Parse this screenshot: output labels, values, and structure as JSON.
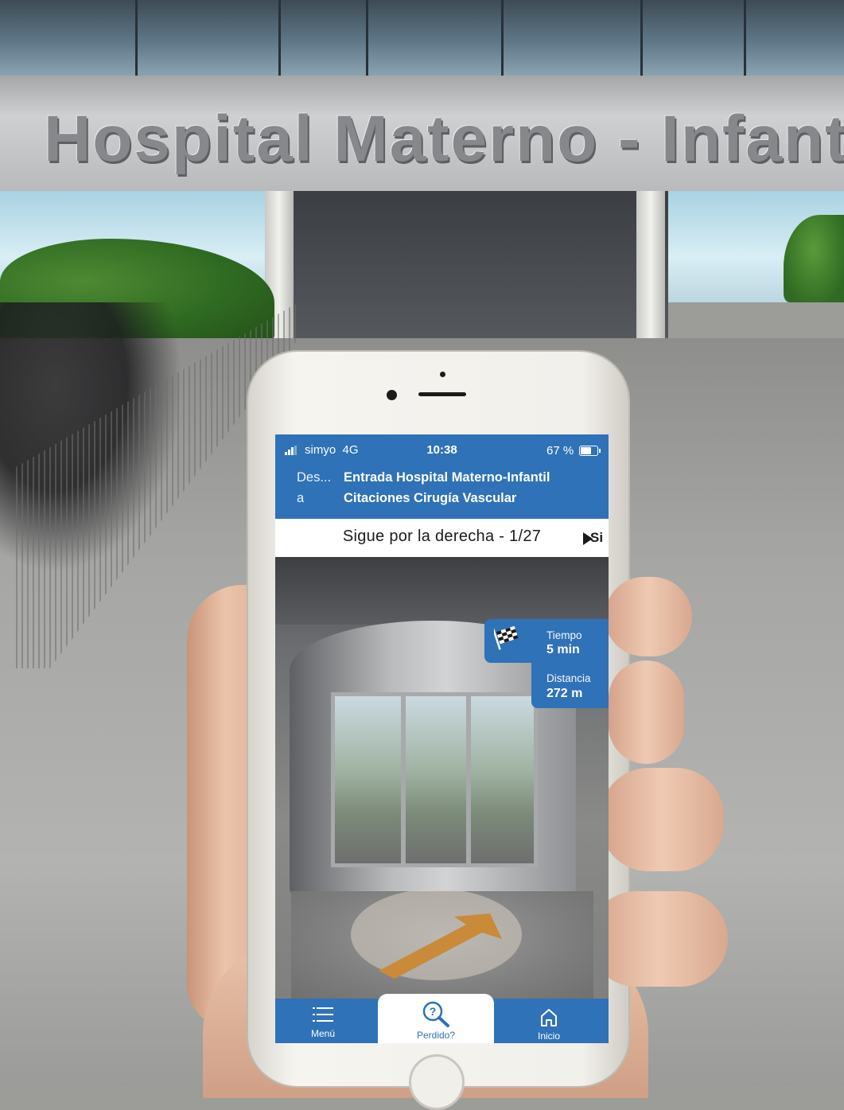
{
  "background": {
    "facade_sign": "Hospital Materno - Infantil"
  },
  "status_bar": {
    "carrier": "simyo",
    "network": "4G",
    "time": "10:38",
    "battery_percent": "67 %",
    "battery_level": 0.67
  },
  "route": {
    "from_label": "Des...",
    "from_value": "Entrada Hospital Materno-Infantil",
    "to_label": "a",
    "to_value": "Citaciones Cirugía Vascular"
  },
  "instruction": {
    "text": "Sigue por la derecha - 1/27",
    "next_label": "Si",
    "next_icon": "play-triangle-icon"
  },
  "info": {
    "time_label": "Tiempo",
    "time_value": "5 min",
    "distance_label": "Distancia",
    "distance_value": "272 m",
    "icon": "checkered-flag-icon"
  },
  "tabs": {
    "menu_label": "Menú",
    "menu_icon": "hamburger-icon",
    "lost_label": "Perdido?",
    "lost_icon": "question-search-icon",
    "home_label": "Inicio",
    "home_icon": "house-icon"
  },
  "colors": {
    "brand_blue": "#2f72b7",
    "ar_arrow": "#c98a3a"
  }
}
